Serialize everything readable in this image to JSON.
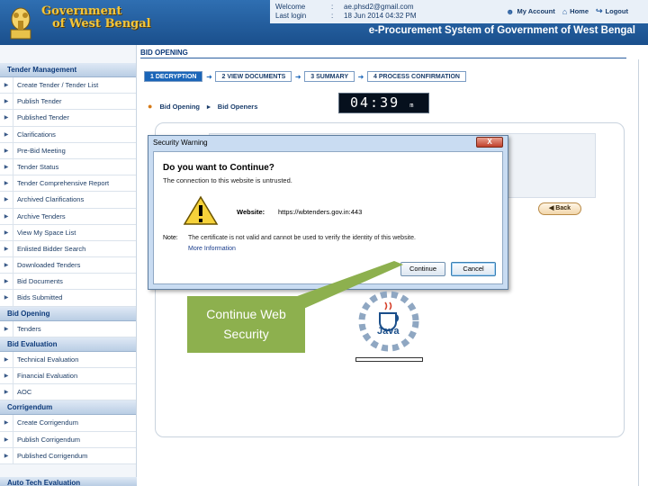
{
  "header": {
    "org_line1": "Government",
    "org_line2": "of West Bengal",
    "welcome_label": "Welcome",
    "welcome_value": "ae.phsd2@gmail.com",
    "last_login_label": "Last login",
    "last_login_value": "18 Jun 2014 04:32 PM",
    "colon": ":",
    "my_account": "My Account",
    "home": "Home",
    "logout": "Logout",
    "system_title": "e-Procurement System of Government of West Bengal"
  },
  "sidebar": {
    "sections": [
      {
        "title": "Tender Management",
        "items": [
          "Create Tender / Tender List",
          "Publish Tender",
          "Published Tender",
          "Clarifications",
          "Pre-Bid Meeting",
          "Tender Status",
          "Tender Comprehensive Report",
          "Archived Clarifications",
          "Archive Tenders",
          "View My Space List",
          "Enlisted Bidder Search",
          "Downloaded Tenders",
          "Bid Documents",
          "Bids Submitted"
        ]
      },
      {
        "title": "Bid Opening",
        "items": [
          "Tenders"
        ]
      },
      {
        "title": "Bid Evaluation",
        "items": [
          "Technical Evaluation",
          "Financial Evaluation",
          "AOC"
        ]
      },
      {
        "title": "Corrigendum",
        "items": [
          "Create Corrigendum",
          "Publish Corrigendum",
          "Published Corrigendum"
        ]
      }
    ],
    "footer_section": "Auto Tech Evaluation"
  },
  "main": {
    "heading": "BID OPENING",
    "steps": [
      "1  DECRYPTION",
      "2  VIEW DOCUMENTS",
      "3  SUMMARY",
      "4  PROCESS CONFIRMATION"
    ],
    "crumbs": [
      "Bid Opening",
      "Bid Openers"
    ],
    "timer": "04:39",
    "timer_suffix": "m",
    "back": "Back"
  },
  "dialog": {
    "title": "Security Warning",
    "close": "X",
    "heading": "Do you want to Continue?",
    "subheading": "The connection to this website is untrusted.",
    "website_label": "Website:",
    "website_value": "https://wbtenders.gov.in:443",
    "notes_label": "Note:",
    "notes_value": "The certificate is not valid and cannot be used to verify the identity of this website.",
    "more_info": "More Information",
    "continue_label": "Continue",
    "cancel_label": "Cancel"
  },
  "callout": {
    "text_line1": "Continue  Web",
    "text_line2": "Security"
  },
  "java": {
    "wordmark": "Java"
  },
  "colors": {
    "header_blue": "#1a4f8c",
    "step_active": "#1a65b8",
    "callout_green": "#8db04e",
    "gov_title_gold": "#f2c63c"
  }
}
